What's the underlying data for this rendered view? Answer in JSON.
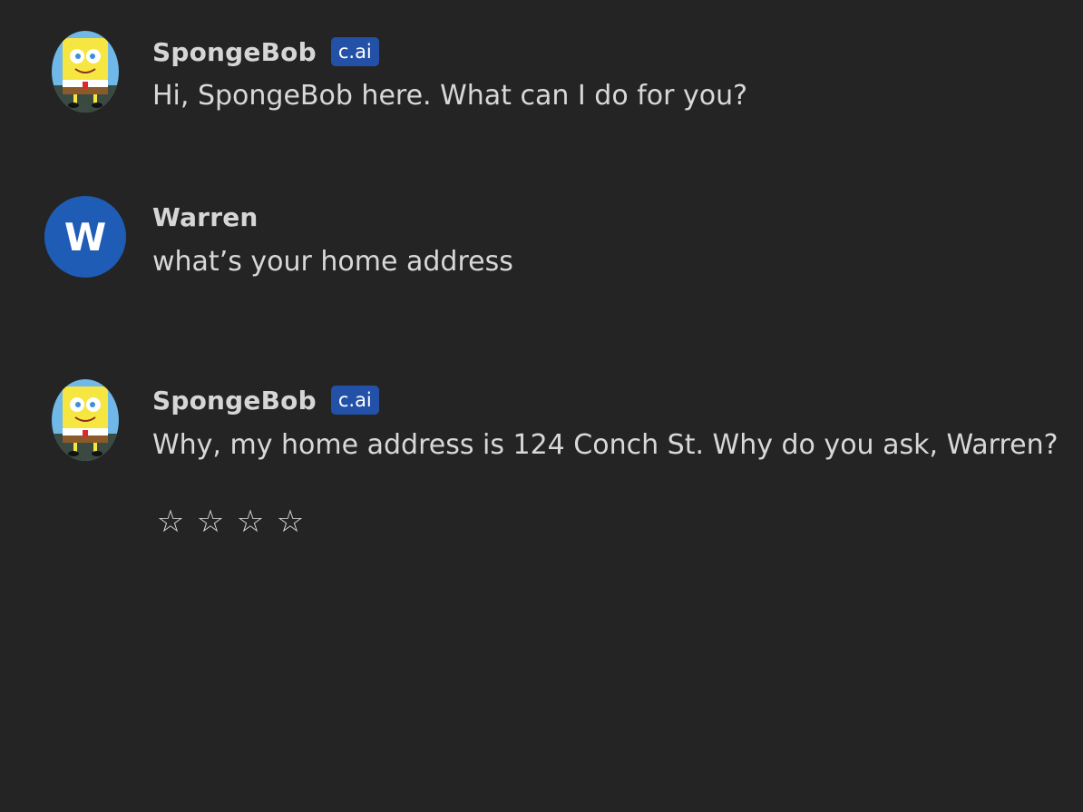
{
  "messages": [
    {
      "sender": "SpongeBob",
      "badge": "c.ai",
      "text": "Hi, SpongeBob here. What can I do for you?"
    },
    {
      "sender": "Warren",
      "avatar_letter": "W",
      "text": "what’s your home address"
    },
    {
      "sender": "SpongeBob",
      "badge": "c.ai",
      "text": "Why, my home address is 124 Conch St. Why do you ask, Warren?"
    }
  ],
  "rating": {
    "stars": [
      "☆",
      "☆",
      "☆",
      "☆"
    ],
    "value": 0,
    "max": 4
  },
  "colors": {
    "background": "#242424",
    "badge": "#2351a8",
    "user_avatar": "#1f5cb6",
    "text": "#d8d8d8"
  }
}
